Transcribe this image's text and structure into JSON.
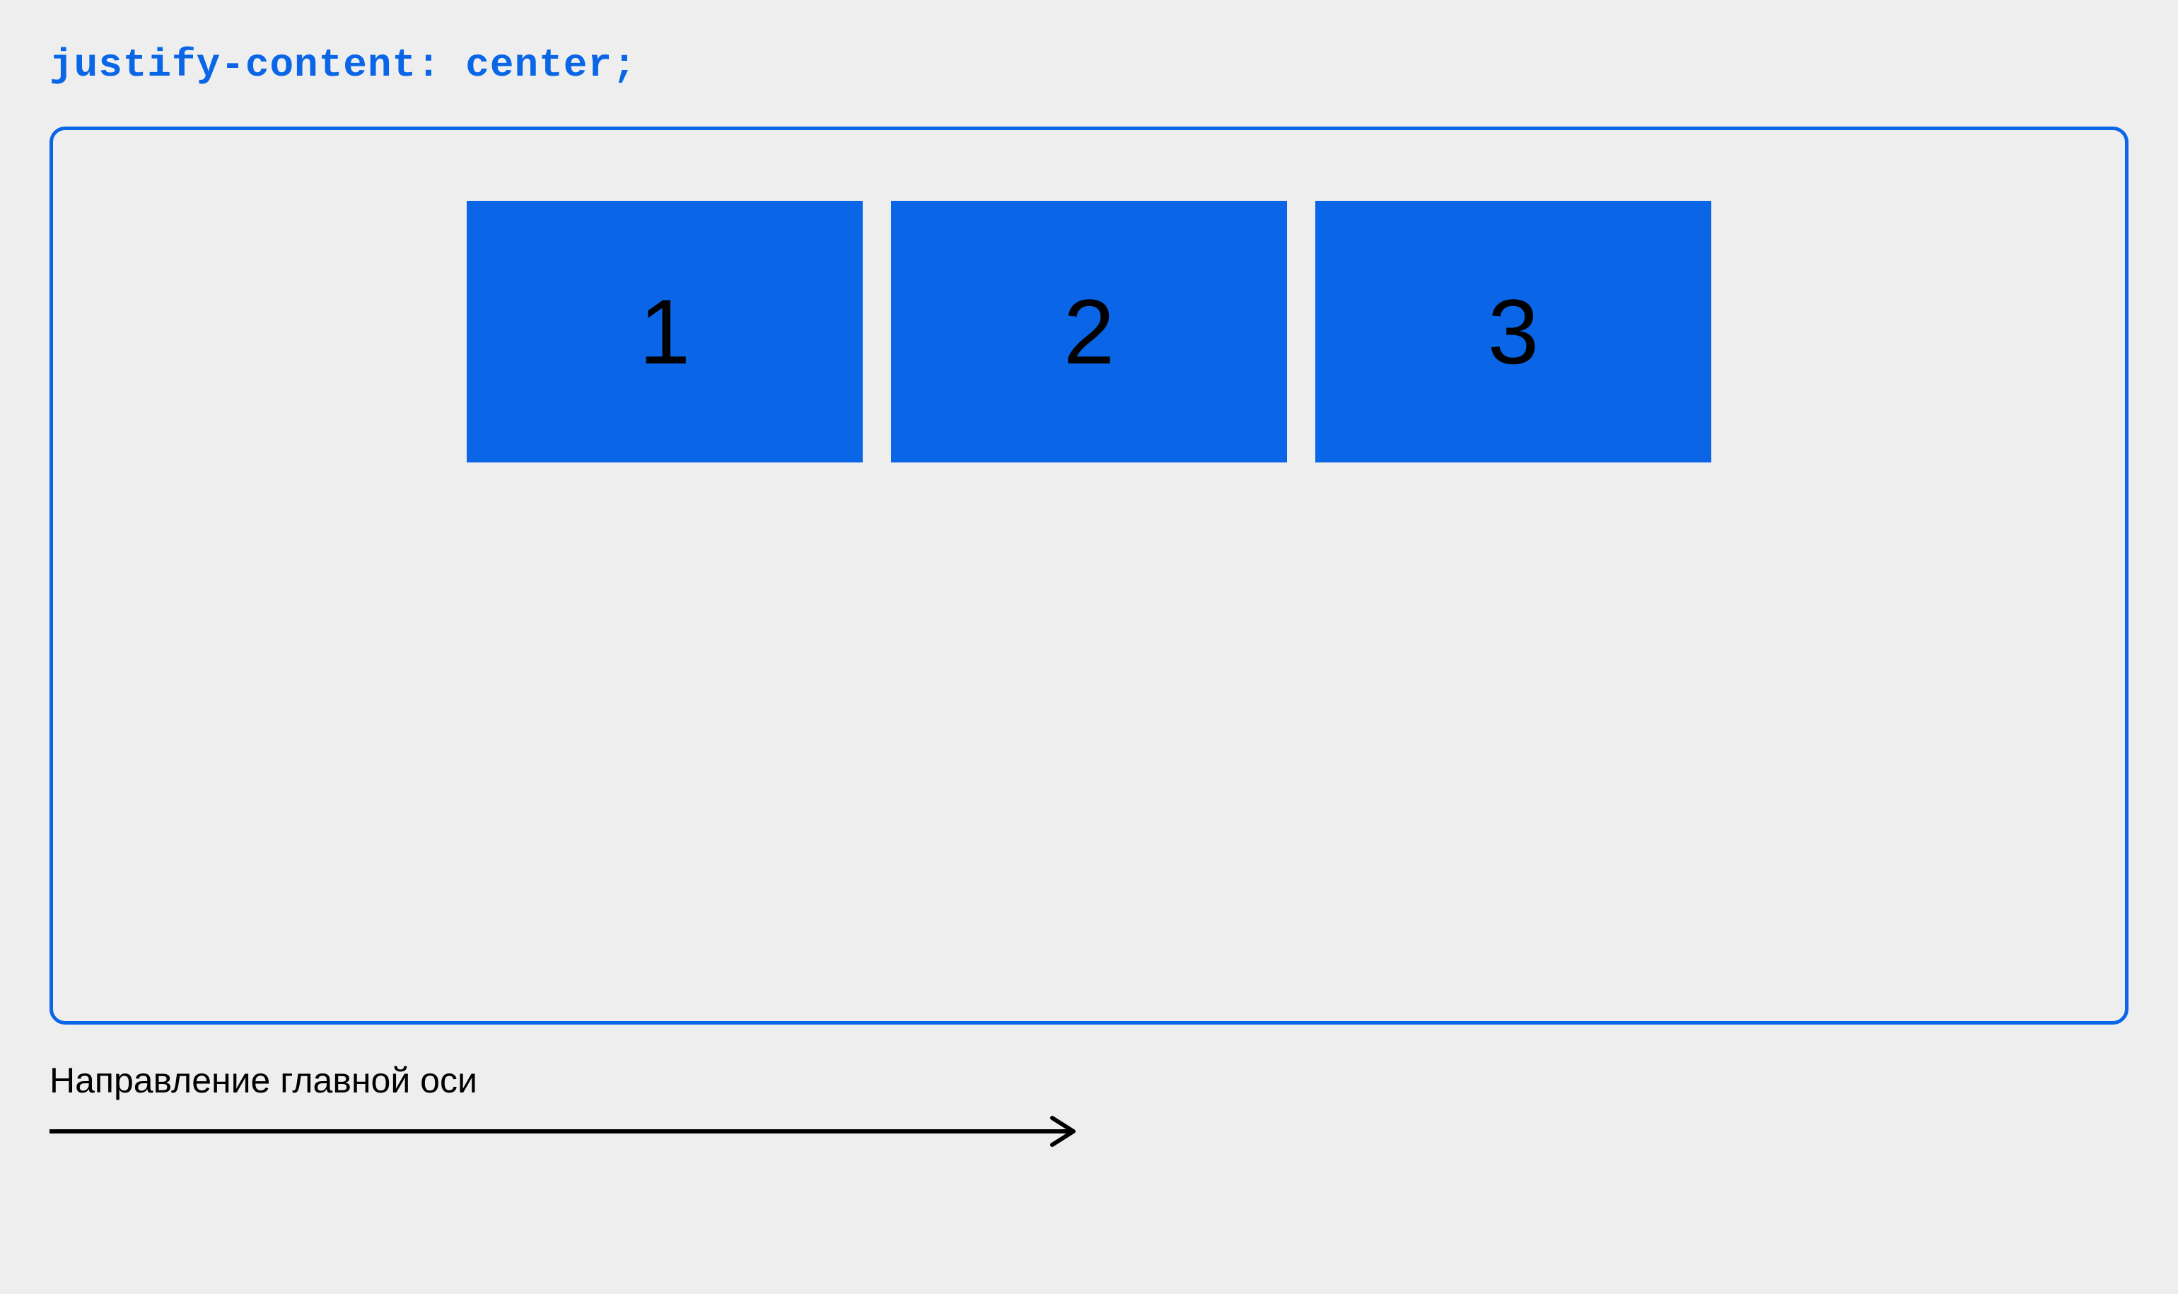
{
  "title": "justify-content: center;",
  "boxes": {
    "b1": "1",
    "b2": "2",
    "b3": "3"
  },
  "axis": {
    "label": "Направление главной оси"
  },
  "colors": {
    "accent": "#0a66e7",
    "bg": "#eeeeee"
  }
}
